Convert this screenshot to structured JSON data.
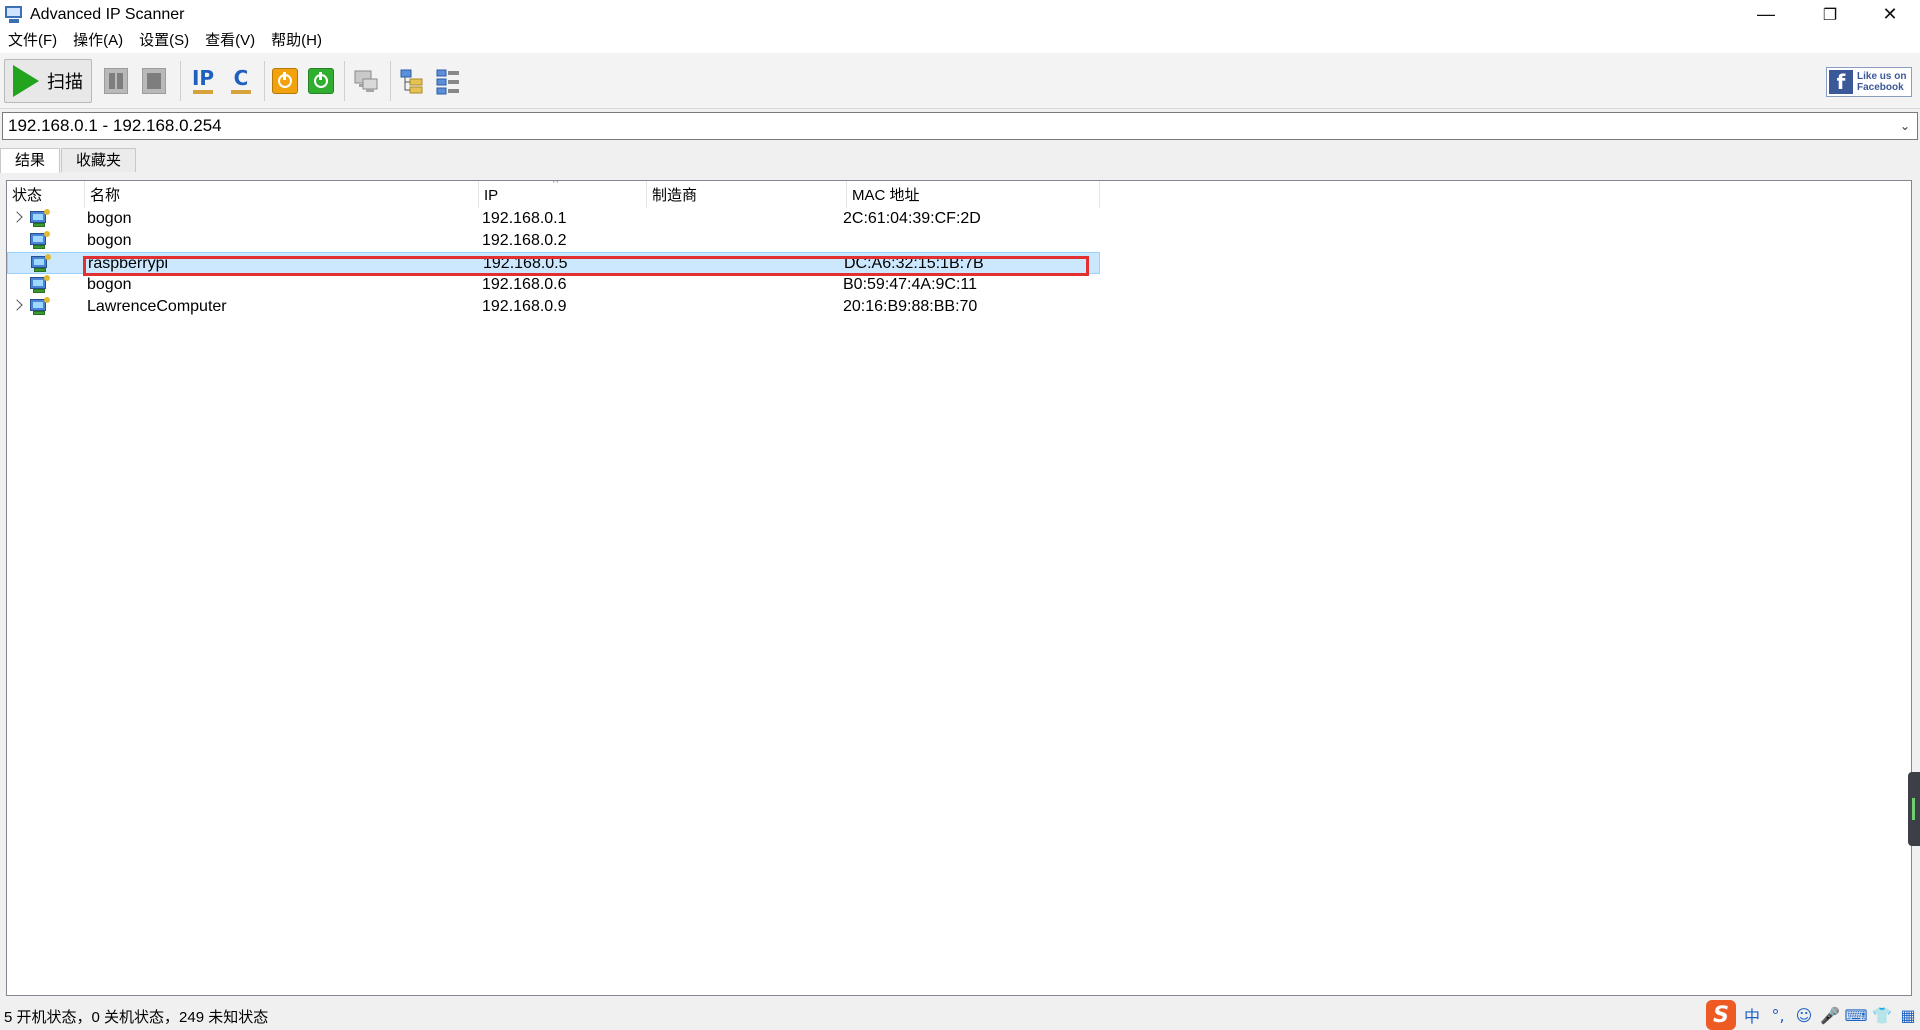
{
  "window": {
    "title": "Advanced IP Scanner",
    "controls": {
      "minimize": "—",
      "maximize": "❐",
      "close": "✕"
    }
  },
  "menu": [
    "文件(F)",
    "操作(A)",
    "设置(S)",
    "查看(V)",
    "帮助(H)"
  ],
  "toolbar": {
    "scan_label": "扫描",
    "ip_label": "IP",
    "c_label": "C",
    "facebook_line1": "Like us on",
    "facebook_line2": "Facebook",
    "facebook_letter": "f"
  },
  "range": {
    "value": "192.168.0.1 - 192.168.0.254"
  },
  "tabs": [
    {
      "label": "结果",
      "active": true
    },
    {
      "label": "收藏夹",
      "active": false
    }
  ],
  "table": {
    "columns": [
      "状态",
      "名称",
      "IP",
      "制造商",
      "MAC 地址"
    ],
    "sorted_column": "IP",
    "rows": [
      {
        "expandable": true,
        "name": "bogon",
        "ip": "192.168.0.1",
        "vendor": "",
        "mac": "2C:61:04:39:CF:2D",
        "selected": false
      },
      {
        "expandable": false,
        "name": "bogon",
        "ip": "192.168.0.2",
        "vendor": "",
        "mac": "",
        "selected": false
      },
      {
        "expandable": false,
        "name": "raspberrypi",
        "ip": "192.168.0.5",
        "vendor": "",
        "mac": "DC:A6:32:15:1B:7B",
        "selected": true
      },
      {
        "expandable": false,
        "name": "bogon",
        "ip": "192.168.0.6",
        "vendor": "",
        "mac": "B0:59:47:4A:9C:11",
        "selected": false
      },
      {
        "expandable": true,
        "name": "LawrenceComputer",
        "ip": "192.168.0.9",
        "vendor": "",
        "mac": "20:16:B9:88:BB:70",
        "selected": false
      }
    ]
  },
  "status": {
    "text": "5 开机状态，0 关机状态，249 未知状态"
  },
  "tray": {
    "ime_logo": "S",
    "ime_mode": "中",
    "punct": "°,",
    "emoji": "☺",
    "mic": "🎤",
    "keyboard": "⌨",
    "skin": "👕",
    "grid": "▦"
  },
  "colors": {
    "scan_green": "#22a41e",
    "selection": "#cce8ff",
    "highlight_red": "#e23030",
    "ip_icon_blue": "#1f5fbd"
  }
}
